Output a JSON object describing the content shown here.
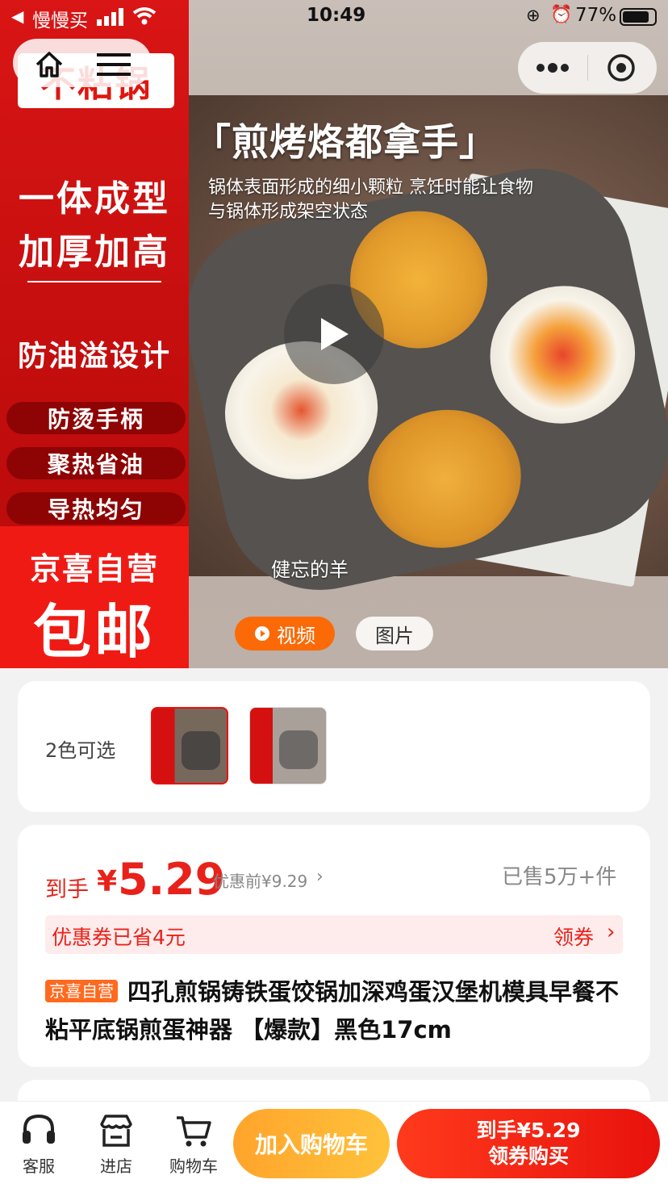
{
  "status_bar": {
    "back_app": "慢慢买",
    "time": "10:49",
    "battery": "77%"
  },
  "hero": {
    "left_panel": {
      "badge": "不粘锅",
      "line1": "一体成型",
      "line2": "加厚加高",
      "line3": "防油溢设计",
      "pills": [
        "防烫手柄",
        "聚热省油",
        "导热均匀"
      ],
      "self_op": "京喜自营",
      "free_ship": "包邮"
    },
    "photo_title": "「煎烤烙都拿手」",
    "photo_sub1": "锅体表面形成的细小颗粒 烹饪时能让食物",
    "photo_sub2": "与锅体形成架空状态",
    "author": "健忘的羊",
    "tab_video": "视频",
    "tab_image": "图片"
  },
  "colors": {
    "label": "2色可选"
  },
  "price": {
    "label": "到手",
    "currency": "¥",
    "value": "5.29",
    "original": "优惠前¥9.29",
    "sold": "已售5万+件",
    "coupon_text": "优惠券已省4元",
    "coupon_action": "领券",
    "tag": "京喜自营",
    "title": "四孔煎锅铸铁蛋饺锅加深鸡蛋汉堡机模具早餐不粘平底锅煎蛋神器 【爆款】黑色17cm"
  },
  "bottom_bar": {
    "service": "客服",
    "store": "进店",
    "cart": "购物车",
    "add_cart": "加入购物车",
    "buy_line1": "到手¥5.29",
    "buy_line2": "领券购买"
  },
  "colors_theme": {
    "primary_red": "#e8120d",
    "orange": "#fb6a06",
    "price_red": "#e8221a"
  }
}
